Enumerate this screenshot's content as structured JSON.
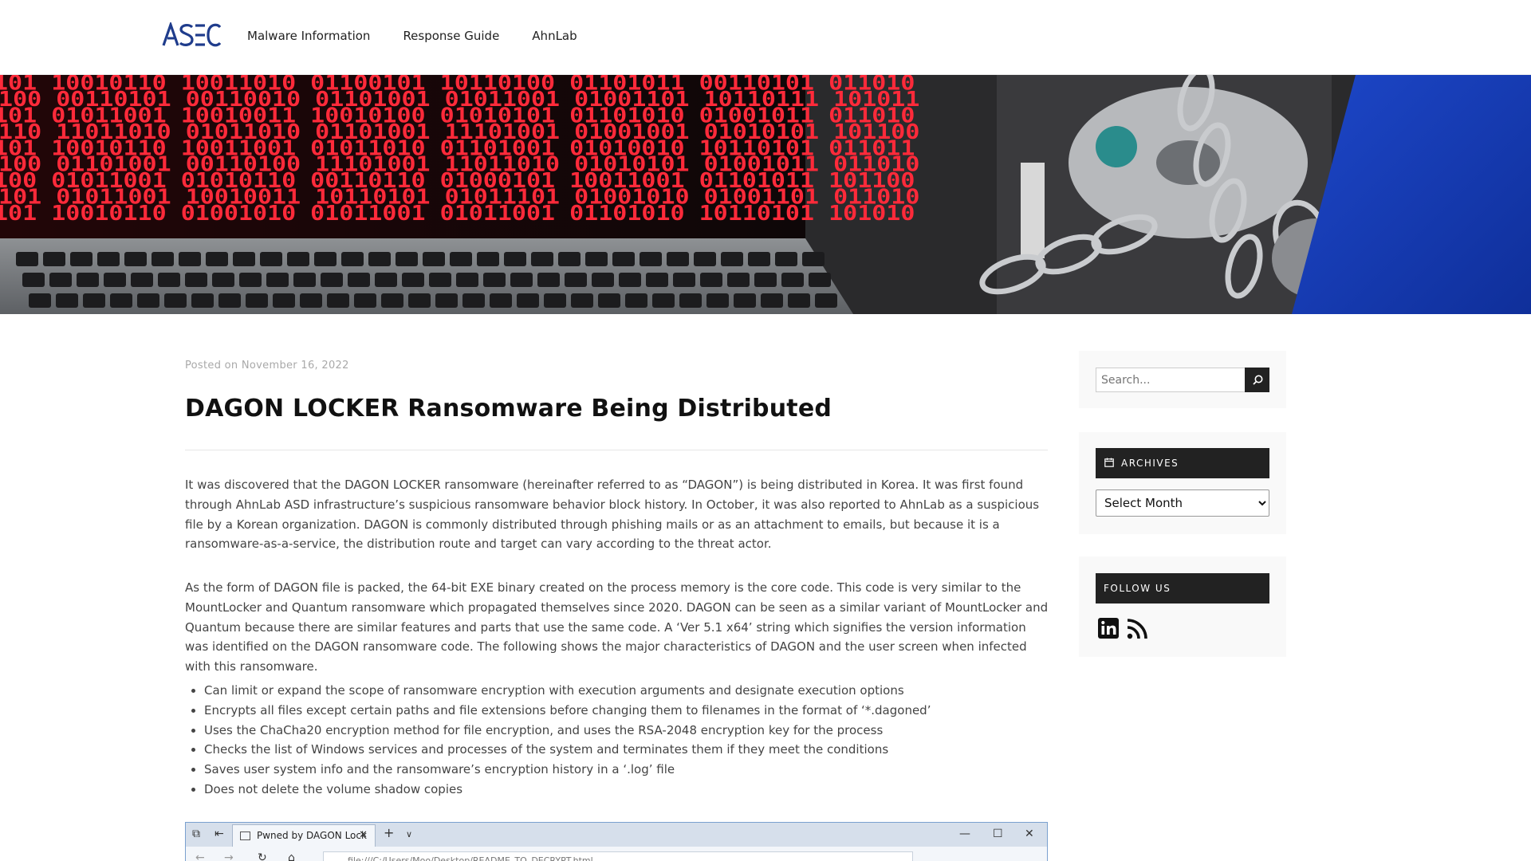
{
  "header": {
    "logo_text": "ASEC",
    "nav": [
      "Malware Information",
      "Response Guide",
      "AhnLab"
    ]
  },
  "hero": {
    "binary_rows": [
      "101 10010110 10011010 01100101 10110100 01101011 00110101 011010",
      "100 00110101 00110010 01101001 01011001 01001101 10110111 101011",
      "101 01011001 10010011 10010100 01010101 01101010 01001011 011010",
      "110 11011010 01011010 01101001 11101001 01001001 01010101 101100",
      "101 10010110 10011001 01011010 01101001 01010010 10110101 011011",
      "100 01101001 00110100 11101001 11011010 01010101 01001011 011010",
      "100 01011001 01010110 00110110 01000101 10011001 01101011 101100",
      "101 01011001 10010011 10110101 01011101 01001010 01001101 011010",
      "101 10010110 01001010 01011001 01011001 01101010 10110101 101010"
    ],
    "colors": {
      "binary": "#ff2a3a",
      "screen": "#1b0a0c",
      "accent": "#1a3fb8"
    }
  },
  "post": {
    "meta": "Posted on November 16, 2022",
    "title": "DAGON LOCKER Ransomware Being Distributed",
    "paragraphs": [
      "It was discovered that the DAGON LOCKER ransomware (hereinafter referred to as “DAGON”) is being distributed in Korea. It was first found through AhnLab ASD infrastructure’s suspicious ransomware behavior block history. In October, it was also reported to AhnLab as a suspicious file by a Korean organization. DAGON is commonly distributed through phishing mails or as an attachment to emails, but because it is a ransomware-as-a-service, the distribution route and target can vary according to the threat actor.",
      "As the form of DAGON file is packed, the 64-bit EXE binary created on the process memory is the core code. This code is very similar to the MountLocker and Quantum ransomware which propagated themselves since 2020. DAGON can be seen as a similar variant of MountLocker and Quantum because there are similar features and parts that use the same code. A ‘Ver 5.1 x64’ string which signifies the version information was identified on the DAGON ransomware code. The following shows the major characteristics of DAGON and the user screen when infected with this ransomware."
    ],
    "bullets": [
      "Can limit or expand the scope of ransomware encryption with execution arguments and designate execution options",
      "Encrypts all files except certain paths and file extensions before changing them to filenames in the format of ‘*.dagoned’",
      "Uses the ChaCha20 encryption method for file encryption, and uses the RSA-2048 encryption key for the process",
      "Checks the list of Windows services and processes of the system and terminates them if they meet the conditions",
      "Saves user system info and the ransomware’s encryption history in a ‘.log’ file",
      "Does not delete the volume shadow copies"
    ],
    "screenshot": {
      "tab_title": "Pwned by DAGON Lock",
      "address": "file:///C:/Users/Moo/Desktop/README_TO_DECRYPT.html"
    }
  },
  "sidebar": {
    "search_placeholder": "Search...",
    "archives_title": "ARCHIVES",
    "archives_select": "Select Month",
    "follow_title": "FOLLOW US",
    "social_icons": [
      "linkedin-icon",
      "rss-icon"
    ]
  }
}
